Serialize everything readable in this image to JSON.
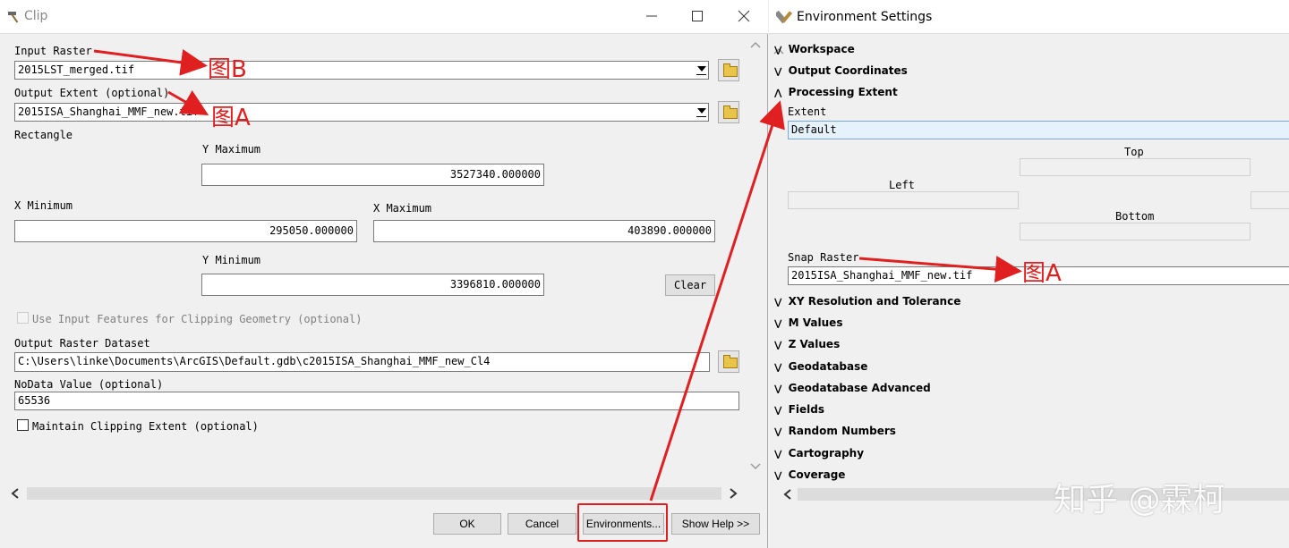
{
  "clip": {
    "title": "Clip",
    "input_raster_label": "Input Raster",
    "input_raster_value": "2015LST_merged.tif",
    "output_extent_label": "Output Extent (optional)",
    "output_extent_value": "2015ISA_Shanghai_MMF_new.tif",
    "rectangle_label": "Rectangle",
    "y_max_label": "Y Maximum",
    "y_max_value": "3527340.000000",
    "x_min_label": "X Minimum",
    "x_min_value": "295050.000000",
    "x_max_label": "X Maximum",
    "x_max_value": "403890.000000",
    "y_min_label": "Y Minimum",
    "y_min_value": "3396810.000000",
    "clear_label": "Clear",
    "use_input_features_label": "Use Input Features for Clipping Geometry (optional)",
    "output_raster_label": "Output Raster Dataset",
    "output_raster_value": "C:\\Users\\linke\\Documents\\ArcGIS\\Default.gdb\\c2015ISA_Shanghai_MMF_new_Cl4",
    "nodata_label": "NoData Value (optional)",
    "nodata_value": "65536",
    "maintain_label": "Maintain Clipping Extent (optional)",
    "ok_label": "OK",
    "cancel_label": "Cancel",
    "environments_label": "Environments...",
    "show_help_label": "Show Help >>"
  },
  "env": {
    "title": "Environment Settings",
    "sections_top": [
      "Workspace",
      "Output Coordinates",
      "Processing Extent"
    ],
    "extent_label": "Extent",
    "extent_value": "Default",
    "top_label": "Top",
    "left_label": "Left",
    "bottom_label": "Bottom",
    "snap_raster_label": "Snap Raster",
    "snap_raster_value": "2015ISA_Shanghai_MMF_new.tif",
    "sections_bottom": [
      "XY Resolution and Tolerance",
      "M Values",
      "Z Values",
      "Geodatabase",
      "Geodatabase Advanced",
      "Fields",
      "Random Numbers",
      "Cartography",
      "Coverage"
    ]
  },
  "annotations": {
    "a1": "图B",
    "a2": "图A",
    "a3": "图A"
  },
  "watermark": "知乎 @霖柯",
  "colors": {
    "annotation_red": "#e02020",
    "extent_highlight": "#e5f1fb"
  }
}
